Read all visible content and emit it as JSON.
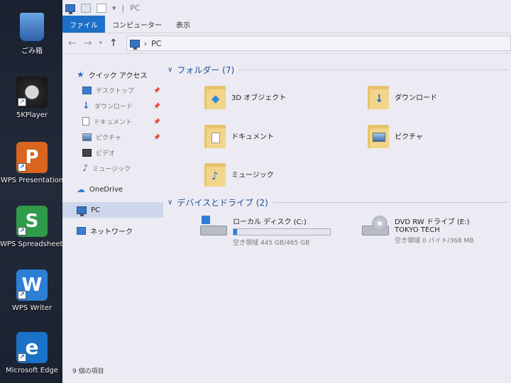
{
  "desktop": {
    "icons": [
      {
        "label": "ごみ箱",
        "icon": "recycle-bin-icon"
      },
      {
        "label": "5KPlayer",
        "icon": "5kplayer-icon"
      },
      {
        "label": "WPS Presentation",
        "icon": "wps-presentation-icon"
      },
      {
        "label": "WPS Spreadsheets",
        "icon": "wps-spreadsheets-icon"
      },
      {
        "label": "WPS Writer",
        "icon": "wps-writer-icon"
      },
      {
        "label": "Microsoft Edge",
        "icon": "edge-icon"
      }
    ]
  },
  "window": {
    "title": "PC",
    "ribbon_tabs": [
      "ファイル",
      "コンピューター",
      "表示"
    ],
    "address": "PC",
    "nav": {
      "quick_access": "クイック アクセス",
      "items": [
        "デスクトップ",
        "ダウンロード",
        "ドキュメント",
        "ピクチャ",
        "ビデオ",
        "ミュージック"
      ],
      "onedrive": "OneDrive",
      "pc": "PC",
      "network": "ネットワーク"
    },
    "folders_header": "フォルダー (7)",
    "folders": [
      "3D オブジェクト",
      "ダウンロード",
      "ドキュメント",
      "ピクチャ",
      "ミュージック"
    ],
    "drives_header": "デバイスとドライブ (2)",
    "drives": [
      {
        "name": "ローカル ディスク (C:)",
        "free": "空き領域 445 GB/465 GB",
        "used_fraction": 0.04
      },
      {
        "name": "DVD RW ドライブ (E:) TOKYO TECH",
        "free": "空き領域 0 バイト/368 MB"
      }
    ],
    "status": "9 個の項目",
    "accent": "#1e6fc7"
  }
}
